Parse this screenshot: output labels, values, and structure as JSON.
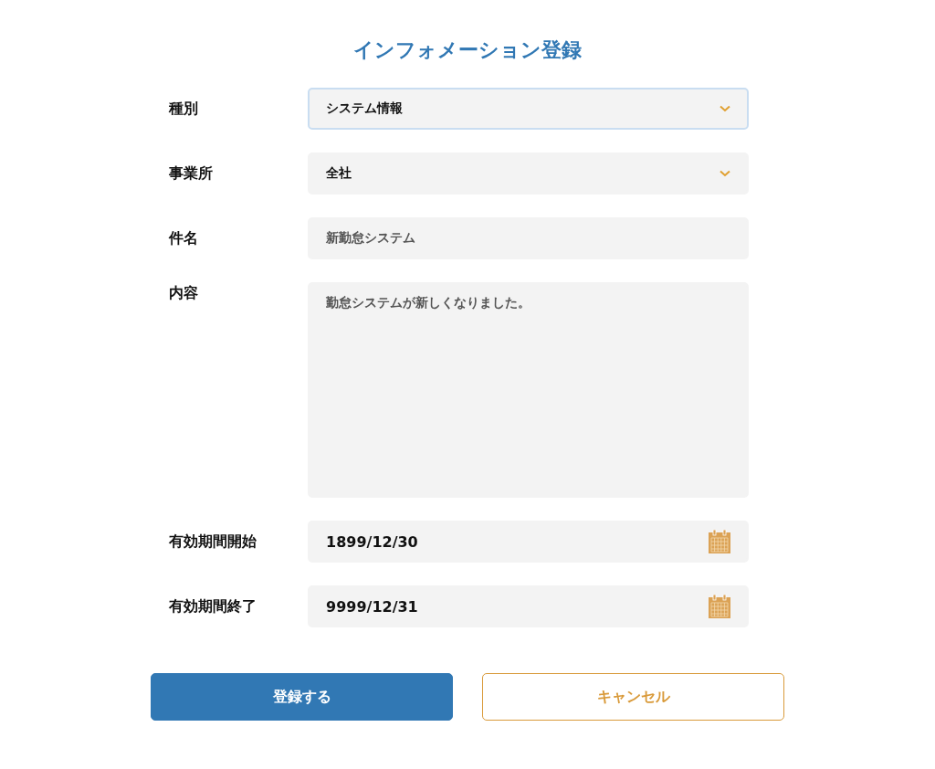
{
  "title": "インフォメーション登録",
  "fields": [
    {
      "label": "種別",
      "kind": "select",
      "value": "システム情報",
      "focused": true
    },
    {
      "label": "事業所",
      "kind": "select",
      "value": "全社",
      "focused": false
    },
    {
      "label": "件名",
      "kind": "text",
      "value": "新勤怠システム",
      "focused": false
    },
    {
      "label": "内容",
      "kind": "textarea",
      "value": "勤怠システムが新しくなりました。",
      "focused": false
    },
    {
      "label": "有効期間開始",
      "kind": "date",
      "value": "1899/12/30",
      "focused": false
    },
    {
      "label": "有効期間終了",
      "kind": "date",
      "value": "9999/12/31",
      "focused": false
    }
  ],
  "buttons": [
    {
      "label": "登録する",
      "kind": "primary"
    },
    {
      "label": "キャンセル",
      "kind": "secondary"
    }
  ]
}
